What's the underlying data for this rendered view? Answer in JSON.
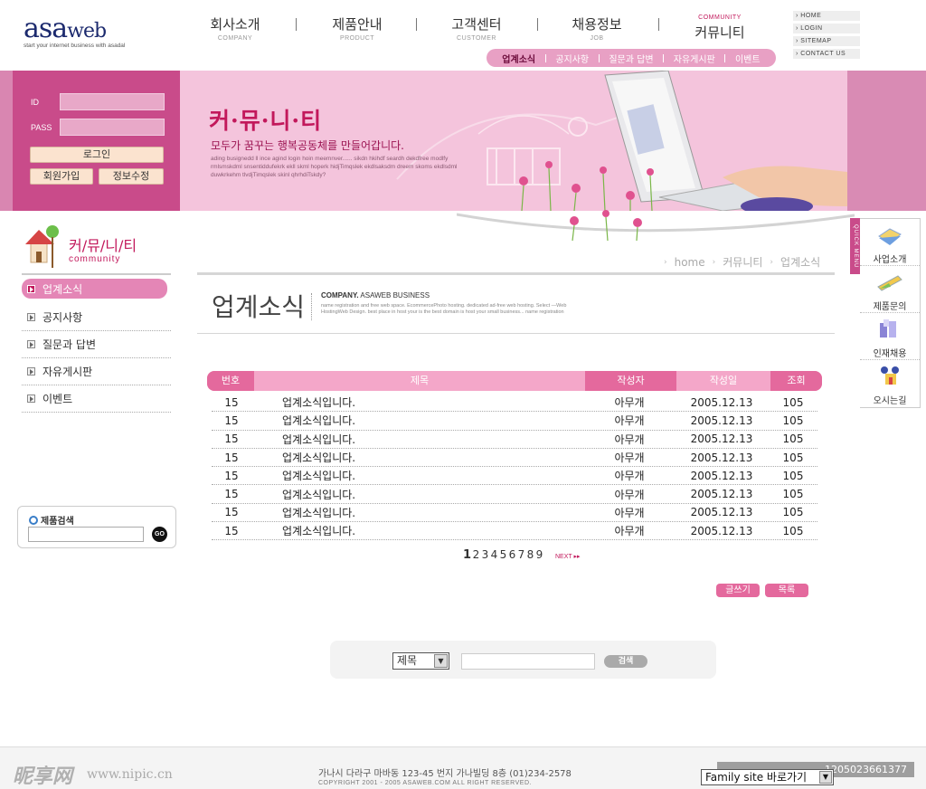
{
  "logo": {
    "mark_main": "asa",
    "mark_sub": "web",
    "tagline": "start your internet business with asadal"
  },
  "gnb": [
    {
      "ko": "회사소개",
      "en": "COMPANY"
    },
    {
      "ko": "제품안내",
      "en": "PRODUCT"
    },
    {
      "ko": "고객센터",
      "en": "CUSTOMER"
    },
    {
      "ko": "채용정보",
      "en": "JOB"
    },
    {
      "ko": "커뮤니티",
      "en": "COMMUNITY"
    }
  ],
  "subnav": [
    "업계소식",
    "공지사항",
    "질문과 답변",
    "자유게시판",
    "이벤트"
  ],
  "util": [
    "HOME",
    "LOGIN",
    "SITEMAP",
    "CONTACT US"
  ],
  "login": {
    "id_label": "ID",
    "pass_label": "PASS",
    "login_btn": "로그인",
    "join_btn": "회원가입",
    "edit_btn": "정보수정"
  },
  "promo": {
    "headline": "커·뮤·니·티",
    "sub": "모두가 꿈꾸는 행복공동체를 만들어갑니다.",
    "small": "ading busignedd ll ince agind login hoin meemnver...... sikdn hkihdf seardh dekdfree modlfy rmlsmskdml snsentiddufekrk ekll skml hoperk hidjTimqslek ekdlsaksdm dreem skoms ekdlsdml duwkrkehm tlvdjTimqslek skinl qhrhdiTskdy?"
  },
  "lnb": {
    "title_ko": "커/뮤/니/티",
    "title_en": "community",
    "items": [
      "업계소식",
      "공지사항",
      "질문과 답변",
      "자유게시판",
      "이벤트"
    ]
  },
  "product_search": {
    "title": "제품검색",
    "go": "GO"
  },
  "breadcrumb": [
    "home",
    "커뮤니티",
    "업계소식"
  ],
  "page": {
    "title": "업계소식",
    "company_bold": "COMPANY.",
    "company": "ASAWEB BUSINESS",
    "desc": "name registration and free web space. EcommercePhoto hosting. dedicated ad-free web hosting. Select —Web HostingWeb Design. best place in host your is the best domain is host your small business... name registration"
  },
  "board": {
    "headers": [
      "번호",
      "제목",
      "작성자",
      "작성일",
      "조회"
    ],
    "rows": [
      [
        "15",
        "업계소식입니다.",
        "아무개",
        "2005.12.13",
        "105"
      ],
      [
        "15",
        "업계소식입니다.",
        "아무개",
        "2005.12.13",
        "105"
      ],
      [
        "15",
        "업계소식입니다.",
        "아무개",
        "2005.12.13",
        "105"
      ],
      [
        "15",
        "업계소식입니다.",
        "아무개",
        "2005.12.13",
        "105"
      ],
      [
        "15",
        "업계소식입니다.",
        "아무개",
        "2005.12.13",
        "105"
      ],
      [
        "15",
        "업계소식입니다.",
        "아무개",
        "2005.12.13",
        "105"
      ],
      [
        "15",
        "업계소식입니다.",
        "아무개",
        "2005.12.13",
        "105"
      ],
      [
        "15",
        "업계소식입니다.",
        "아무개",
        "2005.12.13",
        "105"
      ]
    ]
  },
  "pager": {
    "pages": [
      "1",
      "2",
      "3",
      "4",
      "5",
      "6",
      "7",
      "8",
      "9"
    ],
    "current": "1",
    "next": "NEXT ▸▸"
  },
  "buttons": {
    "write": "글쓰기",
    "list": "목록"
  },
  "search": {
    "select_value": "제목",
    "button": "검색"
  },
  "quick": {
    "tab": "QUICK MENU",
    "items": [
      "사업소개",
      "제품문의",
      "인재채용",
      "오시는길"
    ]
  },
  "footer": {
    "address": "가나시 다라구 마바동 123-45 번지 가나빌딩 8층  (01)234-2578",
    "copyright": "COPYRIGHT 2001 - 2005 ASAWEB.COM ALL RIGHT RESERVED.",
    "family": "Family site 바로가기",
    "watermark": "昵享网",
    "watermark_url": "www.nipic.cn",
    "watermark_id": "1205023661377"
  },
  "colors": {
    "accent": "#c2185b",
    "pink": "#e4699d",
    "light_pink": "#f4c4dc"
  }
}
